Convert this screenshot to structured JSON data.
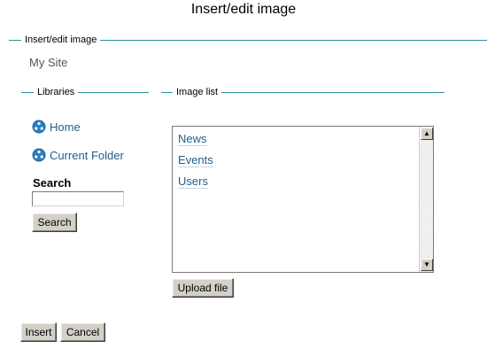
{
  "dialog": {
    "title": "Insert/edit image",
    "main_legend": "Insert/edit image",
    "site_name": "My Site"
  },
  "libraries": {
    "legend": "Libraries",
    "items": [
      {
        "label": "Home",
        "icon": "folder-nav-icon"
      },
      {
        "label": "Current Folder",
        "icon": "folder-nav-icon"
      }
    ],
    "search_label": "Search",
    "search_value": "",
    "search_button": "Search"
  },
  "image_list": {
    "legend": "Image list",
    "items": [
      "News",
      "Events",
      "Users"
    ],
    "upload_button": "Upload file"
  },
  "actions": {
    "insert": "Insert",
    "cancel": "Cancel"
  },
  "colors": {
    "legend_line": "#2e8fa3",
    "link": "#1f5f8b",
    "button_face": "#d4d0c8"
  }
}
